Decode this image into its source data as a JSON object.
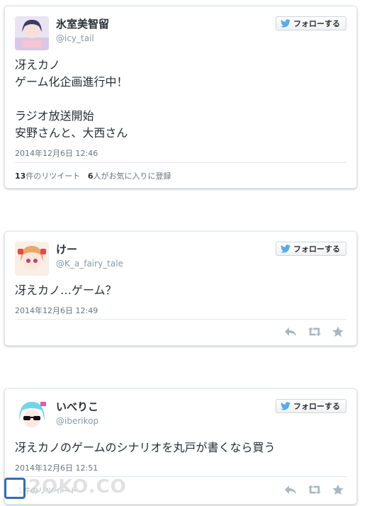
{
  "tweets": [
    {
      "name": "氷室美智留",
      "handle": "@icy_tail",
      "follow_label": "フォローする",
      "text": "冴えカノ\nゲーム化企画進行中！\n\nラジオ放送開始\n安野さんと、大西さん",
      "timestamp": "2014年12月6日 12:46",
      "retweets_count": "13",
      "retweets_label": "件のリツイート",
      "likes_count": "6",
      "likes_label": "人がお気に入りに登録"
    },
    {
      "name": "けー",
      "handle": "@K_a_fairy_tale",
      "follow_label": "フォローする",
      "text": "冴えカノ…ゲーム？",
      "timestamp": "2014年12月6日 12:49"
    },
    {
      "name": "いべりこ",
      "handle": "@iberikop",
      "follow_label": "フォローする",
      "text": "冴えカノのゲームのシナリオを丸戸が書くなら買う",
      "timestamp": "2014年12月6日 12:51",
      "partial_stats": "1件のリツイート"
    }
  ],
  "watermark": {
    "text": "2OKO.CO"
  },
  "colors": {
    "twitter_blue": "#55acee",
    "icon_gray": "#aab8c2"
  },
  "icons": [
    "twitter-bird-icon",
    "reply-icon",
    "retweet-icon",
    "favorite-star-icon"
  ]
}
